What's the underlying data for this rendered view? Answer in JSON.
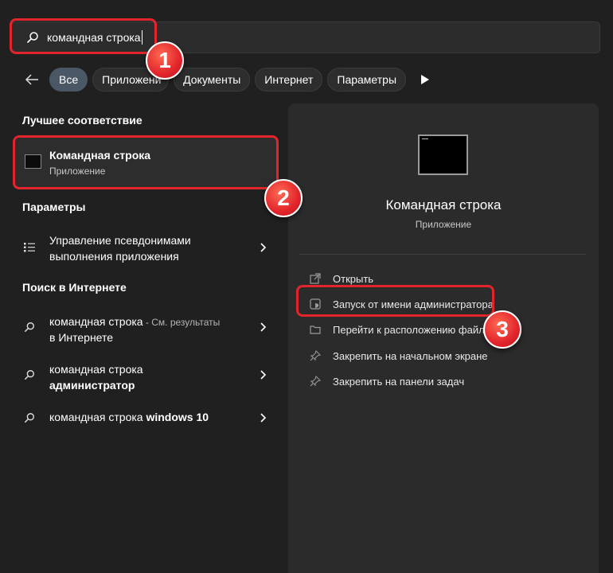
{
  "search": {
    "value": "командная строка"
  },
  "filters": {
    "chips": [
      "Все",
      "Приложени",
      "Документы",
      "Интернет",
      "Параметры"
    ]
  },
  "sections": {
    "best_match": "Лучшее соответствие",
    "settings": "Параметры",
    "web": "Поиск в Интернете"
  },
  "best_match": {
    "title": "Командная строка",
    "subtitle": "Приложение"
  },
  "settings_item": {
    "line1": "Управление псевдонимами",
    "line2": "выполнения приложения"
  },
  "web_results": [
    {
      "text": "командная строка",
      "suffix": " - См. результаты",
      "line2": "в Интернете"
    },
    {
      "text": "командная строка",
      "line2": "администратор"
    },
    {
      "text": "командная строка",
      "bold": " windows 10"
    }
  ],
  "detail": {
    "title": "Командная строка",
    "subtitle": "Приложение",
    "actions": [
      "Открыть",
      "Запуск от имени администратора",
      "Перейти к расположению файла",
      "Закрепить на начальном экране",
      "Закрепить на панели задач"
    ]
  },
  "annotations": {
    "badge1": "1",
    "badge2": "2",
    "badge3": "3"
  },
  "colors": {
    "accent": "#e2252c",
    "background": "#202020",
    "panel": "#2b2b2b",
    "active_chip": "#4a5866"
  }
}
